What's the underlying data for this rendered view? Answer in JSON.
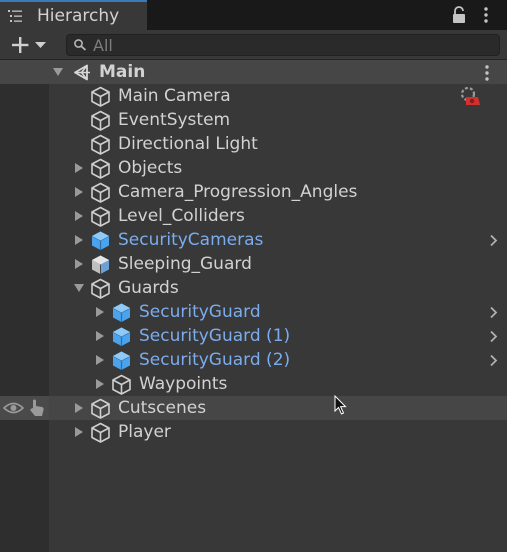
{
  "window": {
    "tab_label": "Hierarchy",
    "tab_icon": "hierarchy-list-icon",
    "lock_icon": "lock-icon",
    "menu_icon": "kebab-menu-icon"
  },
  "toolbar": {
    "add_button_icon": "plus-icon",
    "dropdown_icon": "chevron-down-icon",
    "search_placeholder": "All"
  },
  "scene": {
    "name": "Main",
    "icon": "unity-logo-icon"
  },
  "items": [
    {
      "label": "Main Camera",
      "depth": 0,
      "expandable": false,
      "prefab": false,
      "has_overlay_icon": "missing-script-warning-icon"
    },
    {
      "label": "EventSystem",
      "depth": 0,
      "expandable": false,
      "prefab": false
    },
    {
      "label": "Directional Light",
      "depth": 0,
      "expandable": false,
      "prefab": false
    },
    {
      "label": "Objects",
      "depth": 0,
      "expandable": true,
      "expanded": false,
      "prefab": false
    },
    {
      "label": "Camera_Progression_Angles",
      "depth": 0,
      "expandable": true,
      "expanded": false,
      "prefab": false
    },
    {
      "label": "Level_Colliders",
      "depth": 0,
      "expandable": true,
      "expanded": false,
      "prefab": false
    },
    {
      "label": "SecurityCameras",
      "depth": 0,
      "expandable": true,
      "expanded": false,
      "prefab": true,
      "chevron": true
    },
    {
      "label": "Sleeping_Guard",
      "depth": 0,
      "expandable": true,
      "expanded": false,
      "prefab": "model"
    },
    {
      "label": "Guards",
      "depth": 0,
      "expandable": true,
      "expanded": true,
      "prefab": false
    },
    {
      "label": "SecurityGuard",
      "depth": 1,
      "expandable": true,
      "expanded": false,
      "prefab": true,
      "chevron": true
    },
    {
      "label": "SecurityGuard (1)",
      "depth": 1,
      "expandable": true,
      "expanded": false,
      "prefab": true,
      "chevron": true
    },
    {
      "label": "SecurityGuard (2)",
      "depth": 1,
      "expandable": true,
      "expanded": false,
      "prefab": true,
      "chevron": true
    },
    {
      "label": "Waypoints",
      "depth": 1,
      "expandable": true,
      "expanded": false,
      "prefab": false
    },
    {
      "label": "Cutscenes",
      "depth": 0,
      "expandable": true,
      "expanded": false,
      "prefab": false,
      "hovered": true
    },
    {
      "label": "Player",
      "depth": 0,
      "expandable": true,
      "expanded": false,
      "prefab": false
    }
  ],
  "gutter_icons": {
    "visibility": "eye-icon",
    "pickability": "hand-pointer-icon"
  },
  "colors": {
    "panel": "#383838",
    "gutter": "#2e2e2e",
    "tab_accent": "#3a79bb",
    "prefab_text": "#7bacee",
    "prefab_cube": "#4aa3ec",
    "warning": "#d03030"
  }
}
